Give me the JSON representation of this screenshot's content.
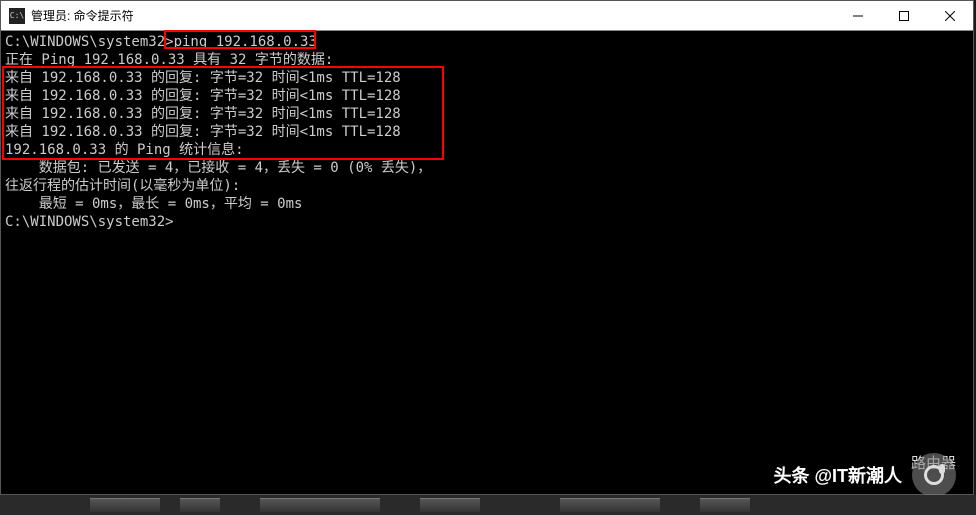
{
  "titlebar": {
    "icon_label": "C:\\",
    "title": "管理员: 命令提示符"
  },
  "console": {
    "prompt1_prefix": "C:\\WINDOWS\\system32>",
    "command": "ping 192.168.0.33",
    "blank1": "",
    "ping_header": "正在 Ping 192.168.0.33 具有 32 字节的数据:",
    "reply1": "来自 192.168.0.33 的回复: 字节=32 时间<1ms TTL=128",
    "reply2": "来自 192.168.0.33 的回复: 字节=32 时间<1ms TTL=128",
    "reply3": "来自 192.168.0.33 的回复: 字节=32 时间<1ms TTL=128",
    "reply4": "来自 192.168.0.33 的回复: 字节=32 时间<1ms TTL=128",
    "blank2": "",
    "stats_header": "192.168.0.33 的 Ping 统计信息:",
    "stats_packets": "    数据包: 已发送 = 4，已接收 = 4，丢失 = 0 (0% 丢失)，",
    "stats_rtt_header": "往返行程的估计时间(以毫秒为单位):",
    "stats_rtt": "    最短 = 0ms，最长 = 0ms，平均 = 0ms",
    "blank3": "",
    "prompt2": "C:\\WINDOWS\\system32>"
  },
  "watermark": {
    "brand_label": "路由器",
    "footer": "头条 @IT新潮人"
  }
}
